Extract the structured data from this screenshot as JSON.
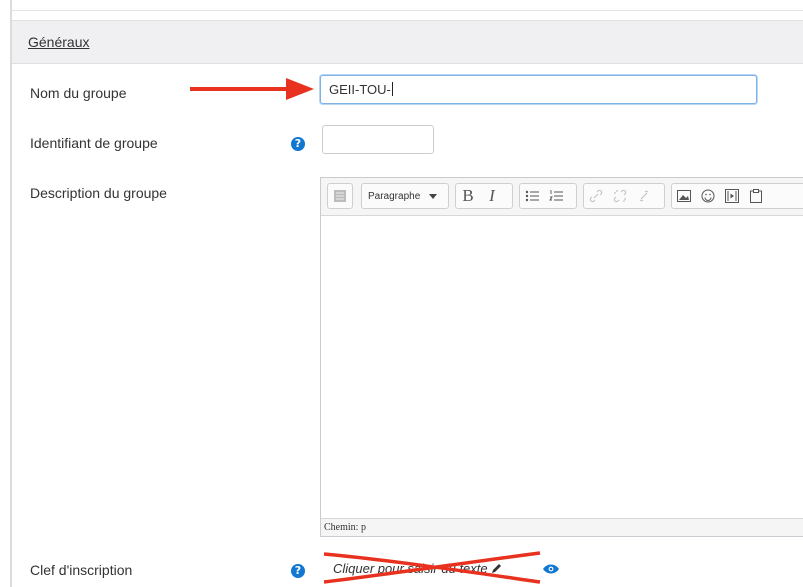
{
  "section": {
    "title": "Généraux"
  },
  "fields": {
    "group_name": {
      "label": "Nom du groupe",
      "value": "GEII-TOU-"
    },
    "group_id": {
      "label": "Identifiant de groupe",
      "value": ""
    },
    "description": {
      "label": "Description du groupe"
    },
    "enrol_key": {
      "label": "Clef d'inscription",
      "link_text": "Cliquer pour saisir du texte"
    }
  },
  "editor": {
    "format_select": "Paragraphe",
    "bold_label": "B",
    "italic_label": "I",
    "path_text": "Chemin: p"
  },
  "help_icon_glyph": "?",
  "colors": {
    "accent": "#1177d1",
    "annotation_red": "#e8321f",
    "header_bg": "#f0f0f2",
    "focus_border": "#7fb3e6"
  },
  "icons": [
    "toolbar-toggle-icon",
    "bullet-list-icon",
    "numbered-list-icon",
    "link-icon",
    "unlink-icon",
    "anchor-icon",
    "image-icon",
    "emoji-icon",
    "media-icon",
    "paste-icon",
    "help-icon",
    "pencil-icon",
    "eye-icon"
  ]
}
